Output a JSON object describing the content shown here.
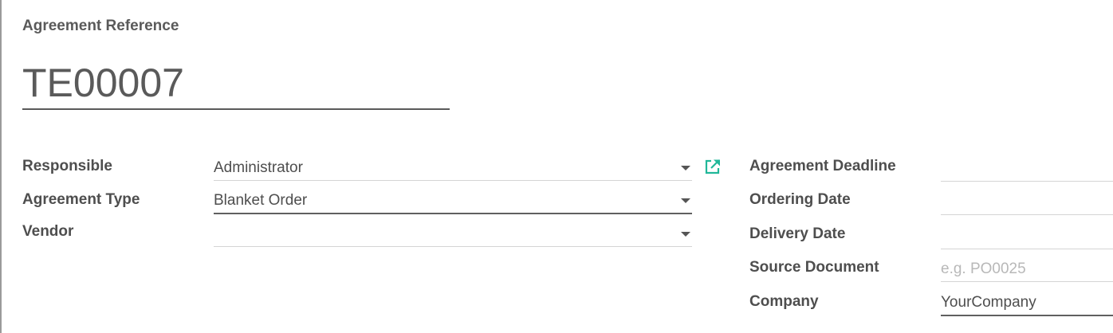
{
  "header": {
    "reference_label": "Agreement Reference",
    "reference_value": "TE00007"
  },
  "left_fields": {
    "responsible": {
      "label": "Responsible",
      "value": "Administrator"
    },
    "agreement_type": {
      "label": "Agreement Type",
      "value": "Blanket Order"
    },
    "vendor": {
      "label": "Vendor",
      "value": ""
    }
  },
  "right_fields": {
    "agreement_deadline": {
      "label": "Agreement Deadline",
      "value": ""
    },
    "ordering_date": {
      "label": "Ordering Date",
      "value": ""
    },
    "delivery_date": {
      "label": "Delivery Date",
      "value": ""
    },
    "source_document": {
      "label": "Source Document",
      "value": "",
      "placeholder": "e.g. PO0025"
    },
    "company": {
      "label": "Company",
      "value": "YourCompany"
    }
  },
  "icons": {
    "dropdown": "chevron-down-icon",
    "external_link": "external-link-icon"
  },
  "colors": {
    "external_link": "#21b799",
    "text": "#4e4e4e",
    "placeholder": "#b8b8b8"
  }
}
